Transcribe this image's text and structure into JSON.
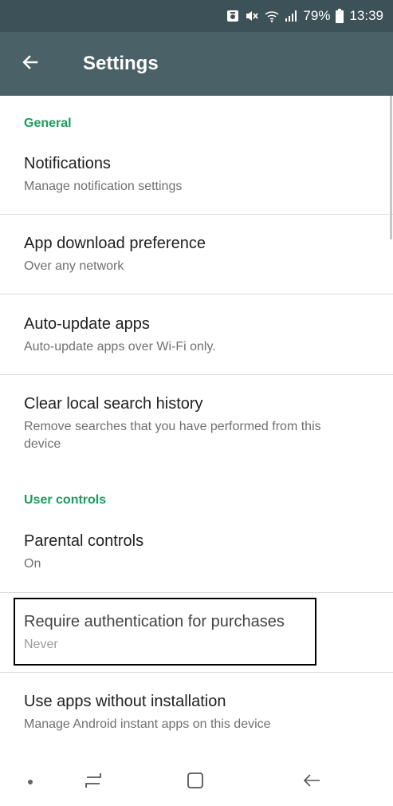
{
  "status_bar": {
    "icons": [
      "photo-notification-icon",
      "mute-icon",
      "wifi-icon",
      "signal-icon",
      "battery-icon"
    ],
    "battery": "79%",
    "time": "13:39"
  },
  "toolbar": {
    "back_icon": "arrow-left-icon",
    "title": "Settings"
  },
  "sections": {
    "general": {
      "header": "General"
    },
    "user_controls": {
      "header": "User controls"
    }
  },
  "rows": {
    "notifications": {
      "title": "Notifications",
      "subtitle": "Manage notification settings"
    },
    "app_download": {
      "title": "App download preference",
      "subtitle": "Over any network"
    },
    "auto_update": {
      "title": "Auto-update apps",
      "subtitle": "Auto-update apps over Wi-Fi only."
    },
    "clear_history": {
      "title": "Clear local search history",
      "subtitle": "Remove searches that you have performed from this device"
    },
    "parental": {
      "title": "Parental controls",
      "subtitle": "On"
    },
    "require_auth": {
      "title": "Require authentication for purchases",
      "subtitle": "Never"
    },
    "instant_apps": {
      "title": "Use apps without installation",
      "subtitle": "Manage Android instant apps on this device"
    }
  },
  "nav_bar": {
    "icons": [
      "dot-icon",
      "recent-apps-icon",
      "home-icon",
      "back-icon"
    ]
  },
  "colors": {
    "status_bar": "#3c5158",
    "toolbar": "#4b6168",
    "section_header": "#1a9c5a"
  }
}
